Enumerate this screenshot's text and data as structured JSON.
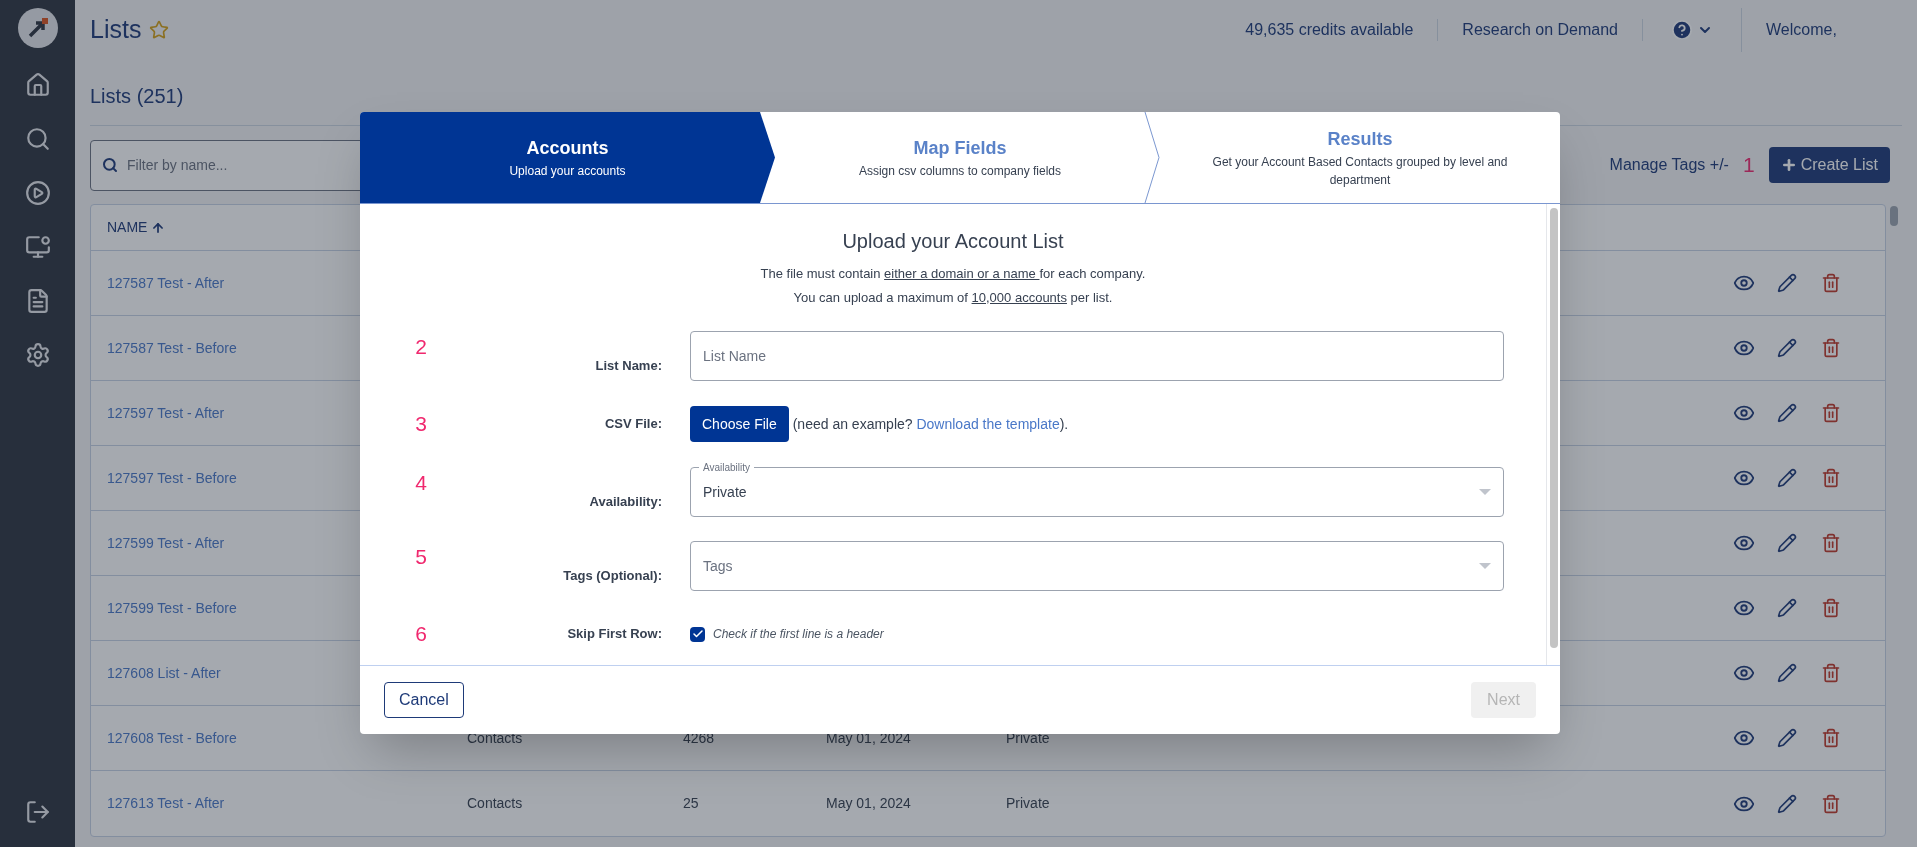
{
  "header": {
    "title": "Lists",
    "favorite": false,
    "credits": "49,635 credits available",
    "research_link": "Research on Demand",
    "welcome": "Welcome,"
  },
  "lists_heading": "Lists (251)",
  "filter": {
    "placeholder": "Filter by name..."
  },
  "manage_tags": "Manage Tags +/-",
  "create_button": {
    "marker": "1",
    "label": "Create List"
  },
  "table": {
    "columns": [
      {
        "label": "NAME",
        "sorted_ascending": true
      }
    ],
    "rows": [
      {
        "name": "127587 Test - After"
      },
      {
        "name": "127587 Test - Before"
      },
      {
        "name": "127597 Test - After"
      },
      {
        "name": "127597 Test - Before"
      },
      {
        "name": "127599 Test - After"
      },
      {
        "name": "127599 Test - Before"
      },
      {
        "name": "127608 List - After"
      },
      {
        "name": "127608 Test - Before",
        "column_2": "Contacts",
        "column_3": "4268",
        "column_4": "May 01, 2024",
        "column_5": "Private"
      },
      {
        "name": "127613 Test - After",
        "column_2": "Contacts",
        "column_3": "25",
        "column_4": "May 01, 2024",
        "column_5": "Private"
      }
    ]
  },
  "modal": {
    "steps": [
      {
        "title": "Accounts",
        "subtitle": "Upload your accounts",
        "selected": true
      },
      {
        "title": "Map Fields",
        "subtitle": "Assign csv columns to company fields",
        "selected": false
      },
      {
        "title": "Results",
        "subtitle": "Get your Account Based Contacts grouped by level and department",
        "selected": false
      }
    ],
    "title": "Upload your Account List",
    "notes": [
      {
        "before": "The file must contain ",
        "underlined": "either a domain or a name ",
        "after": "for each company."
      },
      {
        "before": "You can upload a maximum of ",
        "underlined": "10,000 accounts",
        "after": " per list."
      }
    ],
    "fields": [
      {
        "kind": "text",
        "marker": "2",
        "label": "List Name:",
        "placeholder": "List Name"
      },
      {
        "kind": "file",
        "marker": "3",
        "label": "CSV File:",
        "button": "Choose File",
        "hint_before": "(need an example?",
        "link": "Download the template",
        "hint_after": ")."
      },
      {
        "kind": "select",
        "marker": "4",
        "label": "Availability:",
        "floating_label": "Availability",
        "value": "Private"
      },
      {
        "kind": "select",
        "marker": "5",
        "label": "Tags (Optional):",
        "placeholder": "Tags"
      },
      {
        "kind": "checkbox",
        "marker": "6",
        "label": "Skip First Row:",
        "checked": true,
        "hint": "Check if the first line is a header"
      }
    ],
    "cancel": "Cancel",
    "next": {
      "label": "Next",
      "disabled": true
    }
  }
}
